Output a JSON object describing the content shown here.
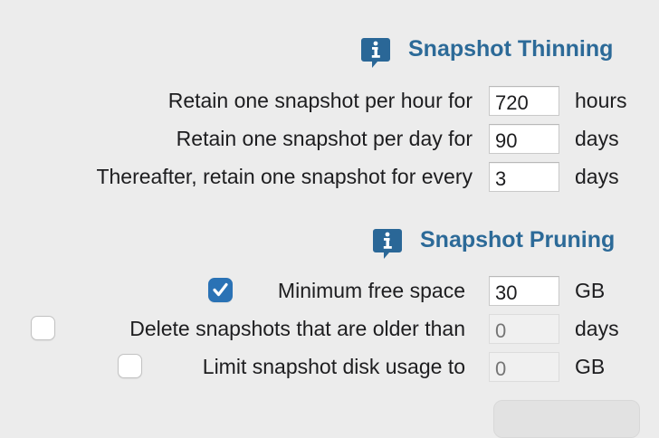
{
  "thinning": {
    "title": "Snapshot Thinning",
    "rows": [
      {
        "label": "Retain one snapshot per hour for",
        "value": "720",
        "unit": "hours"
      },
      {
        "label": "Retain one snapshot per day for",
        "value": "90",
        "unit": "days"
      },
      {
        "label": "Thereafter, retain one snapshot for every",
        "value": "3",
        "unit": "days"
      }
    ]
  },
  "pruning": {
    "title": "Snapshot Pruning",
    "rows": [
      {
        "label": "Minimum free space",
        "checked": true,
        "value": "30",
        "unit": "GB",
        "enabled": true
      },
      {
        "label": "Delete snapshots that are older than",
        "checked": false,
        "placeholder": "0",
        "unit": "days",
        "enabled": false
      },
      {
        "label": "Limit snapshot disk usage to",
        "checked": false,
        "placeholder": "0",
        "unit": "GB",
        "enabled": false
      }
    ]
  },
  "icons": {
    "info": "info-speech-bubble-icon",
    "check": "checkmark-icon"
  },
  "colors": {
    "background": "#ececec",
    "section_title": "#2c6a98",
    "info_icon": "#2a6797",
    "checkbox_checked": "#2a72b5"
  }
}
